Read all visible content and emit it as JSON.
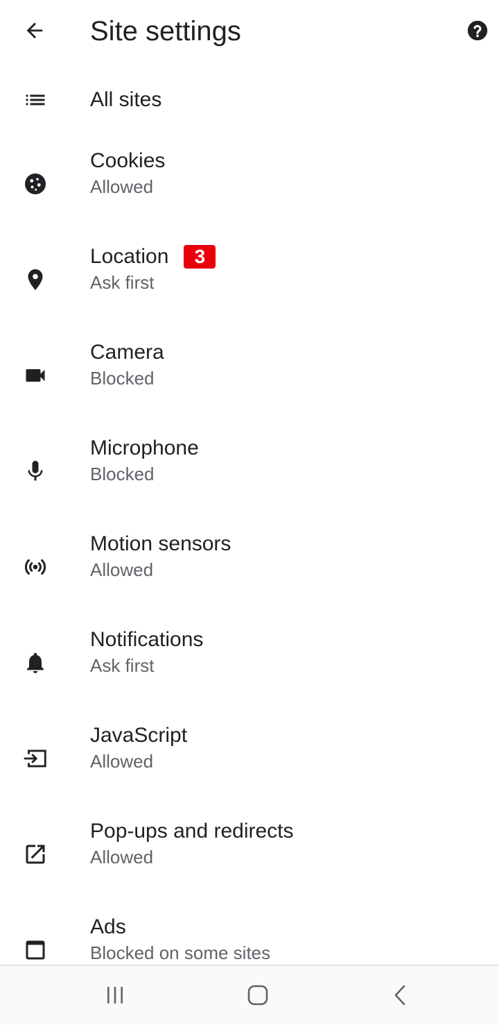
{
  "app_bar": {
    "title": "Site settings",
    "back_icon": "arrow-back-icon",
    "help_icon": "help-icon"
  },
  "items": [
    {
      "title": "All sites",
      "subtitle": "",
      "icon": "list-icon"
    },
    {
      "title": "Cookies",
      "subtitle": "Allowed",
      "icon": "cookie-icon"
    },
    {
      "title": "Location",
      "subtitle": "Ask first",
      "icon": "location-pin-icon",
      "badge": "3"
    },
    {
      "title": "Camera",
      "subtitle": "Blocked",
      "icon": "videocam-icon"
    },
    {
      "title": "Microphone",
      "subtitle": "Blocked",
      "icon": "mic-icon"
    },
    {
      "title": "Motion sensors",
      "subtitle": "Allowed",
      "icon": "sensors-icon"
    },
    {
      "title": "Notifications",
      "subtitle": "Ask first",
      "icon": "bell-icon"
    },
    {
      "title": "JavaScript",
      "subtitle": "Allowed",
      "icon": "javascript-icon"
    },
    {
      "title": "Pop-ups and redirects",
      "subtitle": "Allowed",
      "icon": "open-in-new-icon"
    },
    {
      "title": "Ads",
      "subtitle": "Blocked on some sites",
      "icon": "ads-window-icon"
    }
  ],
  "nav_bar": {
    "recent_icon": "recent-apps-icon",
    "home_icon": "home-icon",
    "back_icon": "nav-back-icon"
  },
  "colors": {
    "badge": "#e8000b",
    "icon": "#202124",
    "subtitle": "#5f6368"
  }
}
